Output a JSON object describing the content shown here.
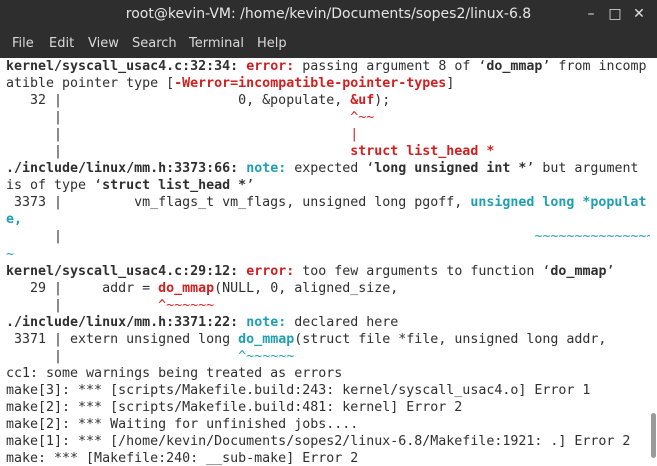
{
  "window": {
    "title": "root@kevin-VM: /home/kevin/Documents/sopes2/linux-6.8",
    "minimize_glyph": "–",
    "maximize_glyph": "□",
    "close_glyph": "✕"
  },
  "menu": [
    "File",
    "Edit",
    "View",
    "Search",
    "Terminal",
    "Help"
  ],
  "colors": {
    "error": "#d21f1f",
    "note": "#1e9fb4",
    "chrome": "#2e2e2e"
  },
  "terminal": {
    "l1": {
      "loc": "kernel/syscall_usac4.c:32:34:",
      "sp": " ",
      "kind": "error:",
      "msg1": " passing argument 8 of ‘",
      "fn": "do_mmap",
      "msg2": "’ from incomp"
    },
    "l2": {
      "pre": "atible pointer type [",
      "flag": "-Werror=incompatible-pointer-types",
      "post": "]"
    },
    "l3": {
      "pre": "   32 |                      0, &populate, ",
      "hl": "&uf",
      "post": ");"
    },
    "l4": {
      "pre": "      |                                    ",
      "mark": "^~~"
    },
    "l5": {
      "pre": "      |                                    ",
      "mark": "|"
    },
    "l6": {
      "pre": "      |                                    ",
      "mark": "struct list_head *"
    },
    "l7": {
      "loc": "./include/linux/mm.h:3373:66:",
      "sp": " ",
      "kind": "note:",
      "msg1": " expected ‘",
      "t": "long unsigned int *",
      "msg2": "’ but argument"
    },
    "l8": {
      "pre": "is of type ‘",
      "t": "struct list_head *",
      "post": "’"
    },
    "l9": {
      "pre": " 3373 |         vm_flags_t vm_flags, unsigned long pgoff, ",
      "hl": "unsigned long *populat"
    },
    "l10": {
      "text": "e,"
    },
    "l11": {
      "pre": "      |                                                           ",
      "mark": "~~~~~~~~~~~~~~~^~~~~~"
    },
    "l12": {
      "mark": "~"
    },
    "l13": {
      "loc": "kernel/syscall_usac4.c:29:12:",
      "sp": " ",
      "kind": "error:",
      "msg1": " too few arguments to function ‘",
      "fn": "do_mmap",
      "msg2": "’"
    },
    "l14": {
      "pre": "   29 |     addr = ",
      "hl": "do_mmap",
      "post": "(NULL, 0, aligned_size,"
    },
    "l15": {
      "pre": "      |            ",
      "mark": "^~~~~~~"
    },
    "l16": {
      "loc": "./include/linux/mm.h:3371:22:",
      "sp": " ",
      "kind": "note:",
      "msg1": " declared here"
    },
    "l17": {
      "pre": " 3371 | extern unsigned long ",
      "hl": "do_mmap",
      "post": "(struct file *file, unsigned long addr,"
    },
    "l18": {
      "pre": "      |                      ",
      "mark": "^~~~~~~"
    },
    "l19": {
      "text": "cc1: some warnings being treated as errors"
    },
    "l20": {
      "text": "make[3]: *** [scripts/Makefile.build:243: kernel/syscall_usac4.o] Error 1"
    },
    "l21": {
      "text": "make[2]: *** [scripts/Makefile.build:481: kernel] Error 2"
    },
    "l22": {
      "text": "make[2]: *** Waiting for unfinished jobs...."
    },
    "l23": {
      "text": "make[1]: *** [/home/kevin/Documents/sopes2/linux-6.8/Makefile:1921: .] Error 2"
    },
    "l24": {
      "text": "make: *** [Makefile:240: __sub-make] Error 2"
    }
  }
}
